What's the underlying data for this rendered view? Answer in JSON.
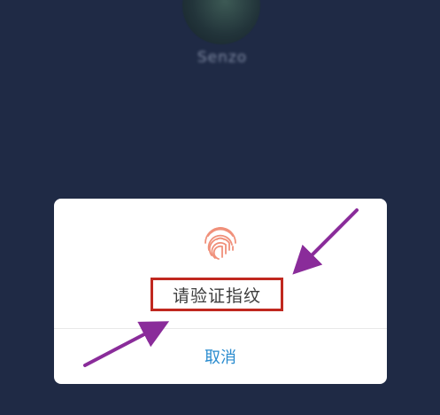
{
  "profile": {
    "username": "Senzo"
  },
  "fingerprint_dialog": {
    "icon": "fingerprint-icon",
    "prompt": "请验证指纹",
    "cancel_label": "取消"
  },
  "colors": {
    "background": "#1f2a45",
    "dialog": "#ffffff",
    "fingerprint": "#f0907a",
    "highlight_box": "#c0281f",
    "annotation_arrow": "#8a2c9a",
    "cancel_text": "#2a8ccf"
  }
}
